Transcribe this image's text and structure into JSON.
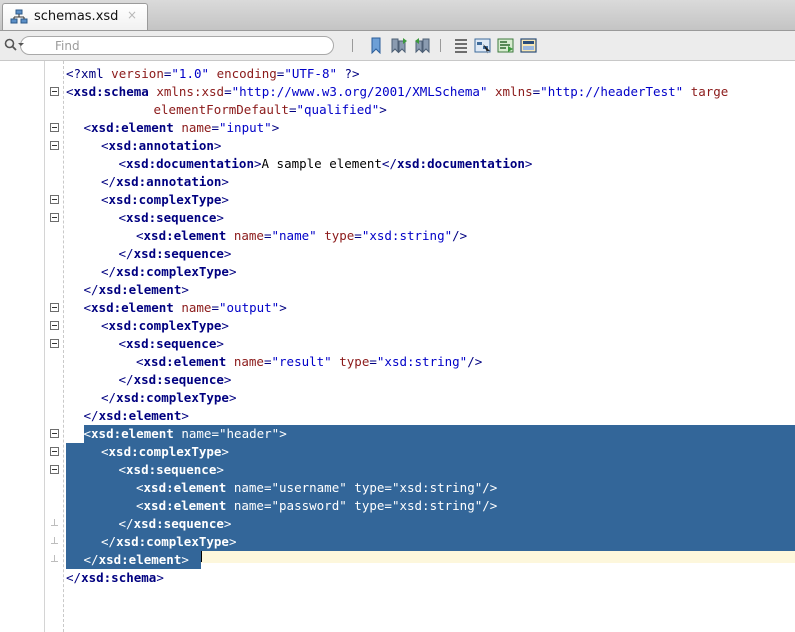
{
  "tab": {
    "title": "schemas.xsd",
    "close_icon": "×",
    "icon": "xml-schema-icon"
  },
  "toolbar": {
    "search_placeholder": "Find",
    "buttons": [
      "toggle-bookmark-icon",
      "previous-bookmark-icon",
      "next-bookmark-icon",
      "indent-icon",
      "design-view-icon",
      "source-view-icon",
      "layout-icon"
    ]
  },
  "colors": {
    "selection": "#336699",
    "current_line": "#fdf7dc",
    "tag": "#000080",
    "attribute": "#8b1a1a",
    "value": "#0000c8"
  },
  "code": {
    "lines": [
      {
        "i": 0,
        "fold": "none",
        "sel": false,
        "tokens": [
          [
            "pi",
            "<?xml"
          ],
          [
            "text",
            " "
          ],
          [
            "attr",
            "version"
          ],
          [
            "punc",
            "="
          ],
          [
            "val",
            "\"1.0\""
          ],
          [
            "text",
            " "
          ],
          [
            "attr",
            "encoding"
          ],
          [
            "punc",
            "="
          ],
          [
            "val",
            "\"UTF-8\""
          ],
          [
            "text",
            " "
          ],
          [
            "pi",
            "?>"
          ]
        ]
      },
      {
        "i": 0,
        "fold": "open",
        "sel": false,
        "tokens": [
          [
            "punc",
            "<"
          ],
          [
            "tag",
            "xsd:schema"
          ],
          [
            "text",
            " "
          ],
          [
            "attr",
            "xmlns:xsd"
          ],
          [
            "punc",
            "="
          ],
          [
            "val",
            "\"http://www.w3.org/2001/XMLSchema\""
          ],
          [
            "text",
            " "
          ],
          [
            "attr",
            "xmlns"
          ],
          [
            "punc",
            "="
          ],
          [
            "val",
            "\"http://headerTest\""
          ],
          [
            "text",
            " "
          ],
          [
            "attr",
            "targe"
          ]
        ]
      },
      {
        "i": 5,
        "fold": "none",
        "sel": false,
        "tokens": [
          [
            "attr",
            "elementFormDefault"
          ],
          [
            "punc",
            "="
          ],
          [
            "val",
            "\"qualified\""
          ],
          [
            "punc",
            ">"
          ]
        ]
      },
      {
        "i": 1,
        "fold": "open",
        "sel": false,
        "tokens": [
          [
            "punc",
            "<"
          ],
          [
            "tag",
            "xsd:element"
          ],
          [
            "text",
            " "
          ],
          [
            "attr",
            "name"
          ],
          [
            "punc",
            "="
          ],
          [
            "val",
            "\"input\""
          ],
          [
            "punc",
            ">"
          ]
        ]
      },
      {
        "i": 2,
        "fold": "open",
        "sel": false,
        "tokens": [
          [
            "punc",
            "<"
          ],
          [
            "tag",
            "xsd:annotation"
          ],
          [
            "punc",
            ">"
          ]
        ]
      },
      {
        "i": 3,
        "fold": "none",
        "sel": false,
        "tokens": [
          [
            "punc",
            "<"
          ],
          [
            "tag",
            "xsd:documentation"
          ],
          [
            "punc",
            ">"
          ],
          [
            "text",
            "A sample element"
          ],
          [
            "punc",
            "</"
          ],
          [
            "tag",
            "xsd:documentation"
          ],
          [
            "punc",
            ">"
          ]
        ]
      },
      {
        "i": 2,
        "fold": "none",
        "sel": false,
        "tokens": [
          [
            "punc",
            "</"
          ],
          [
            "tag",
            "xsd:annotation"
          ],
          [
            "punc",
            ">"
          ]
        ]
      },
      {
        "i": 2,
        "fold": "open",
        "sel": false,
        "tokens": [
          [
            "punc",
            "<"
          ],
          [
            "tag",
            "xsd:complexType"
          ],
          [
            "punc",
            ">"
          ]
        ]
      },
      {
        "i": 3,
        "fold": "open",
        "sel": false,
        "tokens": [
          [
            "punc",
            "<"
          ],
          [
            "tag",
            "xsd:sequence"
          ],
          [
            "punc",
            ">"
          ]
        ]
      },
      {
        "i": 4,
        "fold": "none",
        "sel": false,
        "tokens": [
          [
            "punc",
            "<"
          ],
          [
            "tag",
            "xsd:element"
          ],
          [
            "text",
            " "
          ],
          [
            "attr",
            "name"
          ],
          [
            "punc",
            "="
          ],
          [
            "val",
            "\"name\""
          ],
          [
            "text",
            " "
          ],
          [
            "attr",
            "type"
          ],
          [
            "punc",
            "="
          ],
          [
            "val",
            "\"xsd:string\""
          ],
          [
            "punc",
            "/>"
          ]
        ]
      },
      {
        "i": 3,
        "fold": "none",
        "sel": false,
        "tokens": [
          [
            "punc",
            "</"
          ],
          [
            "tag",
            "xsd:sequence"
          ],
          [
            "punc",
            ">"
          ]
        ]
      },
      {
        "i": 2,
        "fold": "none",
        "sel": false,
        "tokens": [
          [
            "punc",
            "</"
          ],
          [
            "tag",
            "xsd:complexType"
          ],
          [
            "punc",
            ">"
          ]
        ]
      },
      {
        "i": 1,
        "fold": "none",
        "sel": false,
        "tokens": [
          [
            "punc",
            "</"
          ],
          [
            "tag",
            "xsd:element"
          ],
          [
            "punc",
            ">"
          ]
        ]
      },
      {
        "i": 1,
        "fold": "open",
        "sel": false,
        "tokens": [
          [
            "punc",
            "<"
          ],
          [
            "tag",
            "xsd:element"
          ],
          [
            "text",
            " "
          ],
          [
            "attr",
            "name"
          ],
          [
            "punc",
            "="
          ],
          [
            "val",
            "\"output\""
          ],
          [
            "punc",
            ">"
          ]
        ]
      },
      {
        "i": 2,
        "fold": "open",
        "sel": false,
        "tokens": [
          [
            "punc",
            "<"
          ],
          [
            "tag",
            "xsd:complexType"
          ],
          [
            "punc",
            ">"
          ]
        ]
      },
      {
        "i": 3,
        "fold": "open",
        "sel": false,
        "tokens": [
          [
            "punc",
            "<"
          ],
          [
            "tag",
            "xsd:sequence"
          ],
          [
            "punc",
            ">"
          ]
        ]
      },
      {
        "i": 4,
        "fold": "none",
        "sel": false,
        "tokens": [
          [
            "punc",
            "<"
          ],
          [
            "tag",
            "xsd:element"
          ],
          [
            "text",
            " "
          ],
          [
            "attr",
            "name"
          ],
          [
            "punc",
            "="
          ],
          [
            "val",
            "\"result\""
          ],
          [
            "text",
            " "
          ],
          [
            "attr",
            "type"
          ],
          [
            "punc",
            "="
          ],
          [
            "val",
            "\"xsd:string\""
          ],
          [
            "punc",
            "/>"
          ]
        ]
      },
      {
        "i": 3,
        "fold": "none",
        "sel": false,
        "tokens": [
          [
            "punc",
            "</"
          ],
          [
            "tag",
            "xsd:sequence"
          ],
          [
            "punc",
            ">"
          ]
        ]
      },
      {
        "i": 2,
        "fold": "none",
        "sel": false,
        "tokens": [
          [
            "punc",
            "</"
          ],
          [
            "tag",
            "xsd:complexType"
          ],
          [
            "punc",
            ">"
          ]
        ]
      },
      {
        "i": 1,
        "fold": "none",
        "sel": false,
        "tokens": [
          [
            "punc",
            "</"
          ],
          [
            "tag",
            "xsd:element"
          ],
          [
            "punc",
            ">"
          ]
        ]
      },
      {
        "i": 1,
        "fold": "open",
        "sel": true,
        "tokens": [
          [
            "punc",
            "<"
          ],
          [
            "tag",
            "xsd:element"
          ],
          [
            "text",
            " "
          ],
          [
            "attr",
            "name"
          ],
          [
            "punc",
            "="
          ],
          [
            "val",
            "\"header\""
          ],
          [
            "punc",
            ">"
          ]
        ]
      },
      {
        "i": 2,
        "fold": "open",
        "sel": true,
        "tokens": [
          [
            "punc",
            "<"
          ],
          [
            "tag",
            "xsd:complexType"
          ],
          [
            "punc",
            ">"
          ]
        ]
      },
      {
        "i": 3,
        "fold": "open",
        "sel": true,
        "tokens": [
          [
            "punc",
            "<"
          ],
          [
            "tag",
            "xsd:sequence"
          ],
          [
            "punc",
            ">"
          ]
        ]
      },
      {
        "i": 4,
        "fold": "none",
        "sel": true,
        "tokens": [
          [
            "punc",
            "<"
          ],
          [
            "tag",
            "xsd:element"
          ],
          [
            "text",
            " "
          ],
          [
            "attr",
            "name"
          ],
          [
            "punc",
            "="
          ],
          [
            "val",
            "\"username\""
          ],
          [
            "text",
            " "
          ],
          [
            "attr",
            "type"
          ],
          [
            "punc",
            "="
          ],
          [
            "val",
            "\"xsd:string\""
          ],
          [
            "punc",
            "/>"
          ]
        ]
      },
      {
        "i": 4,
        "fold": "none",
        "sel": true,
        "tokens": [
          [
            "punc",
            "<"
          ],
          [
            "tag",
            "xsd:element"
          ],
          [
            "text",
            " "
          ],
          [
            "attr",
            "name"
          ],
          [
            "punc",
            "="
          ],
          [
            "val",
            "\"password\""
          ],
          [
            "text",
            " "
          ],
          [
            "attr",
            "type"
          ],
          [
            "punc",
            "="
          ],
          [
            "val",
            "\"xsd:string\""
          ],
          [
            "punc",
            "/>"
          ]
        ]
      },
      {
        "i": 3,
        "fold": "end",
        "sel": true,
        "tokens": [
          [
            "punc",
            "</"
          ],
          [
            "tag",
            "xsd:sequence"
          ],
          [
            "punc",
            ">"
          ]
        ]
      },
      {
        "i": 2,
        "fold": "end",
        "sel": true,
        "tokens": [
          [
            "punc",
            "</"
          ],
          [
            "tag",
            "xsd:complexType"
          ],
          [
            "punc",
            ">"
          ]
        ]
      },
      {
        "i": 1,
        "fold": "end",
        "sel": true,
        "tokens": [
          [
            "punc",
            "</"
          ],
          [
            "tag",
            "xsd:element"
          ],
          [
            "punc",
            ">"
          ]
        ]
      },
      {
        "i": 0,
        "fold": "none",
        "sel": false,
        "tokens": [
          [
            "punc",
            "</"
          ],
          [
            "tag",
            "xsd:schema"
          ],
          [
            "punc",
            ">"
          ]
        ]
      }
    ]
  }
}
